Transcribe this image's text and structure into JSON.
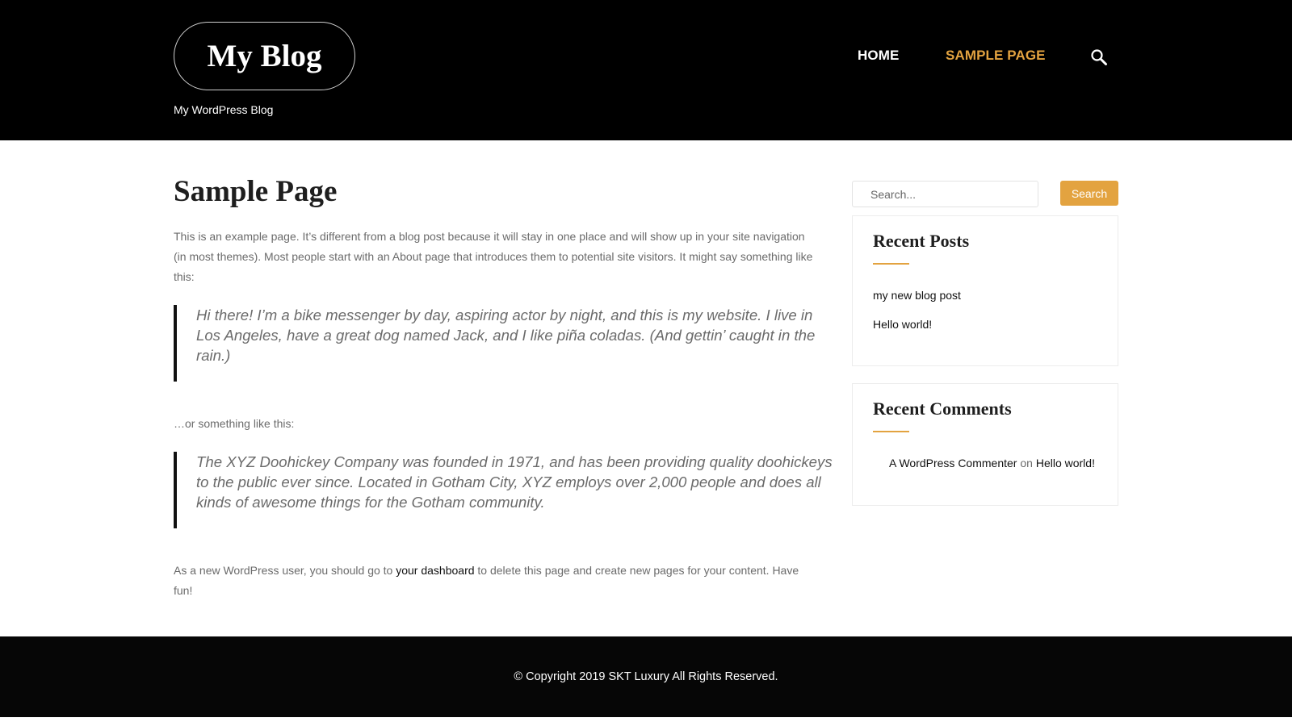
{
  "header": {
    "site_title": "My Blog",
    "tagline": "My WordPress Blog",
    "nav": [
      {
        "label": "HOME"
      },
      {
        "label": "SAMPLE PAGE"
      }
    ],
    "search_icon": "search-icon"
  },
  "main": {
    "title": "Sample Page",
    "intro": "This is an example page. It’s different from a blog post because it will stay in one place and will show up in your site navigation (in most themes). Most people start with an About page that introduces them to potential site visitors. It might say something like this:",
    "quote1": "Hi there! I’m a bike messenger by day, aspiring actor by night, and this is my website. I live in Los Angeles, have a great dog named Jack, and I like piña coladas. (And gettin’ caught in the rain.)",
    "middle": "…or something like this:",
    "quote2": "The XYZ Doohickey Company was founded in 1971, and has been providing quality doohickeys to the public ever since. Located in Gotham City, XYZ employs over 2,000 people and does all kinds of awesome things for the Gotham community.",
    "outro_before": "As a new WordPress user, you should go to ",
    "outro_link": "your dashboard",
    "outro_after": " to delete this page and create new pages for your content. Have fun!"
  },
  "sidebar": {
    "search_placeholder": "Search...",
    "search_button": "Search",
    "recent_posts": {
      "title": "Recent Posts",
      "items": [
        "my new blog post",
        "Hello world!"
      ]
    },
    "recent_comments": {
      "title": "Recent Comments",
      "author": "A WordPress Commenter",
      "on": "on",
      "post": "Hello world!"
    }
  },
  "footer": {
    "copyright": "© Copyright 2019 SKT Luxury All Rights Reserved."
  },
  "colors": {
    "accent": "#e3a340",
    "header_bg": "#000000",
    "footer_bg": "#060606"
  }
}
